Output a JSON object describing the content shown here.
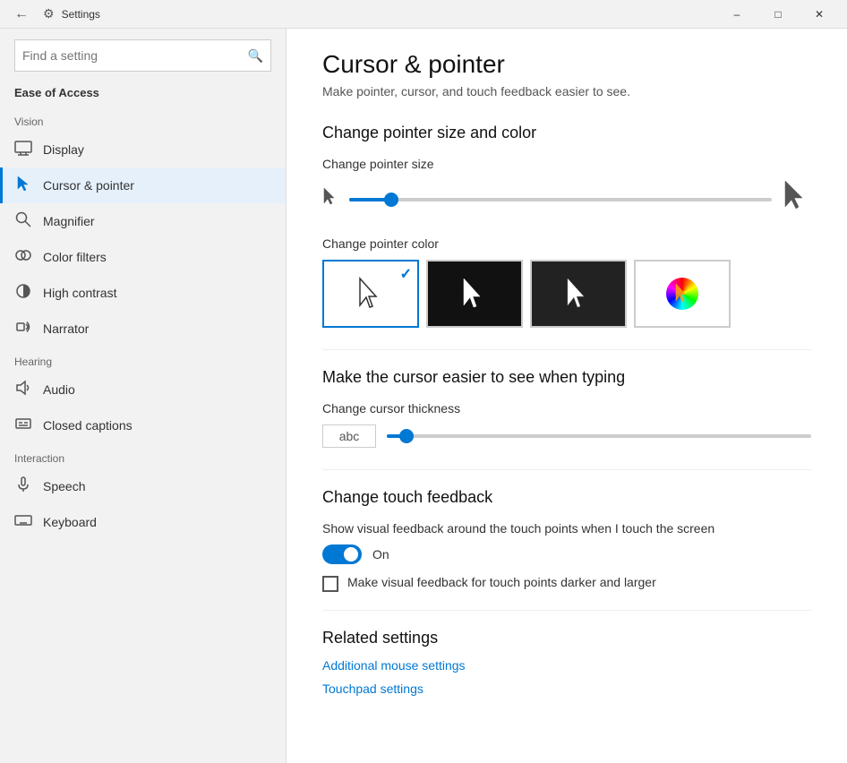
{
  "titlebar": {
    "title": "Settings",
    "minimize": "–",
    "maximize": "□",
    "close": "✕"
  },
  "sidebar": {
    "search_placeholder": "Find a setting",
    "section_label": "Ease of Access",
    "vision_label": "Vision",
    "items_vision": [
      {
        "id": "display",
        "icon": "🖥",
        "label": "Display"
      },
      {
        "id": "cursor-pointer",
        "icon": "🖱",
        "label": "Cursor & pointer"
      },
      {
        "id": "magnifier",
        "icon": "🔍",
        "label": "Magnifier"
      },
      {
        "id": "color-filters",
        "icon": "🎨",
        "label": "Color filters"
      },
      {
        "id": "high-contrast",
        "icon": "☀",
        "label": "High contrast"
      },
      {
        "id": "narrator",
        "icon": "📢",
        "label": "Narrator"
      }
    ],
    "hearing_label": "Hearing",
    "items_hearing": [
      {
        "id": "audio",
        "icon": "🔊",
        "label": "Audio"
      },
      {
        "id": "closed-captions",
        "icon": "💬",
        "label": "Closed captions"
      }
    ],
    "interaction_label": "Interaction",
    "items_interaction": [
      {
        "id": "speech",
        "icon": "🎤",
        "label": "Speech"
      },
      {
        "id": "keyboard",
        "icon": "⌨",
        "label": "Keyboard"
      }
    ]
  },
  "content": {
    "title": "Cursor & pointer",
    "subtitle": "Make pointer, cursor, and touch feedback easier to see.",
    "pointer_size_section": "Change pointer size and color",
    "pointer_size_label": "Change pointer size",
    "pointer_size_value": 10,
    "pointer_color_label": "Change pointer color",
    "color_options": [
      {
        "id": "white",
        "label": "White cursor",
        "selected": true
      },
      {
        "id": "black",
        "label": "Black cursor",
        "selected": false
      },
      {
        "id": "inverted",
        "label": "Inverted cursor",
        "selected": false
      },
      {
        "id": "custom",
        "label": "Custom cursor",
        "selected": false
      }
    ],
    "cursor_section": "Make the cursor easier to see when typing",
    "cursor_thickness_label": "Change cursor thickness",
    "cursor_thickness_preview": "abc",
    "cursor_thickness_value": 3,
    "touch_section": "Change touch feedback",
    "touch_toggle_label": "Show visual feedback around the touch points when I touch the screen",
    "touch_toggle_state": "On",
    "touch_checkbox_label": "Make visual feedback for touch points darker and larger",
    "related_section": "Related settings",
    "link1": "Additional mouse settings",
    "link2": "Touchpad settings"
  }
}
